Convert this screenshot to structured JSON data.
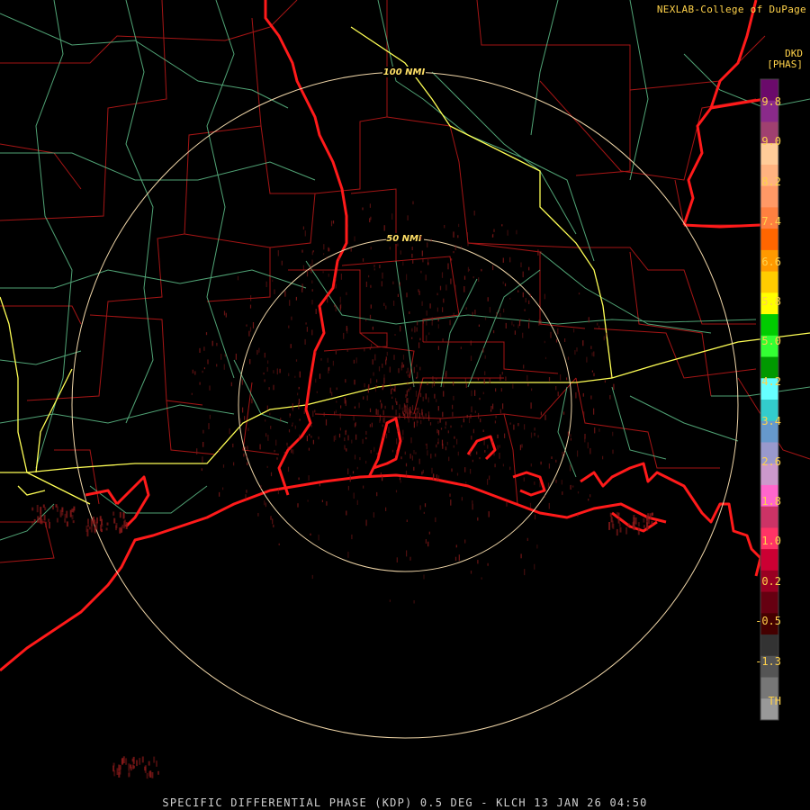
{
  "credit": "NEXLAB-College of DuPage",
  "product_code": "DKD",
  "units": "[PHAS]",
  "footer": "SPECIFIC DIFFERENTIAL PHASE (KDP) 0.5 DEG - KLCH 13 JAN 26 04:50",
  "range_rings": [
    {
      "label": "50 NMI"
    },
    {
      "label": "100 NMI"
    }
  ],
  "scale": {
    "labels": [
      "9.8",
      "9.0",
      "8.2",
      "7.4",
      "6.6",
      "5.8",
      "5.0",
      "4.2",
      "3.4",
      "2.6",
      "1.8",
      "1.0",
      "0.2",
      "-0.5",
      "-1.3",
      "TH"
    ],
    "colors": [
      "#6b0a6b",
      "#8a2a8a",
      "#a04070",
      "#ffcc99",
      "#ffb380",
      "#ff9966",
      "#ff8040",
      "#ff6600",
      "#ff9900",
      "#ffcc00",
      "#ffff00",
      "#00cc00",
      "#33ff33",
      "#009900",
      "#66ffff",
      "#33cccc",
      "#6699cc",
      "#9999cc",
      "#cc99cc",
      "#ff66cc",
      "#cc3366",
      "#ff3366",
      "#cc0033",
      "#990022",
      "#660011",
      "#440000",
      "#333333",
      "#555555",
      "#777777",
      "#999999"
    ]
  },
  "colors": {
    "background": "#000000",
    "coast": "#ff1a1a",
    "county_lines": "#b01010",
    "highways": "#ffff66",
    "roads": "#66cc88",
    "rings": "#f5d6a0",
    "echo": "#8a1a1a"
  }
}
